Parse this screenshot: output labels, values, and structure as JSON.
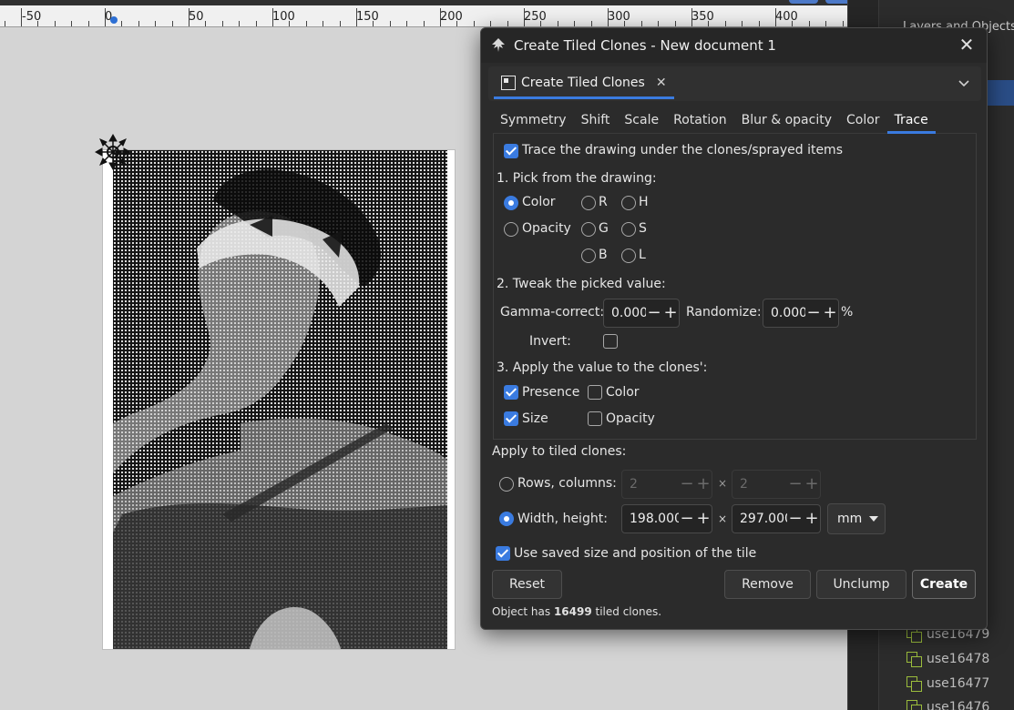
{
  "ruler": {
    "labels": [
      "-50",
      "0",
      "50",
      "100",
      "150",
      "200",
      "250",
      "300",
      "350",
      "400"
    ]
  },
  "side_panel": {
    "tab_title": "Layers and Objects",
    "layers": [
      {
        "label": "use16479"
      },
      {
        "label": "use16478"
      },
      {
        "label": "use16477"
      },
      {
        "label": "use16476"
      }
    ]
  },
  "dialog": {
    "title": "Create Tiled Clones - New document 1",
    "tab_label": "Create Tiled Clones",
    "tabs": [
      {
        "label": "Symmetry"
      },
      {
        "label": "Shift"
      },
      {
        "label": "Scale"
      },
      {
        "label": "Rotation"
      },
      {
        "label": "Blur & opacity"
      },
      {
        "label": "Color"
      },
      {
        "label": "Trace",
        "active": true
      }
    ],
    "trace": {
      "trace_label": "Trace the drawing under the clones/sprayed items",
      "trace_checked": true,
      "pick_heading": "1. Pick from the drawing:",
      "pick_options": {
        "color": "Color",
        "opacity": "Opacity",
        "r": "R",
        "g": "G",
        "b": "B",
        "h": "H",
        "s": "S",
        "l": "L"
      },
      "pick_selected": "Color",
      "tweak_heading": "2. Tweak the picked value:",
      "gamma_label": "Gamma-correct:",
      "gamma_value": "0.000",
      "randomize_label": "Randomize:",
      "randomize_value": "0.000",
      "randomize_unit": "%",
      "invert_label": "Invert:",
      "invert_checked": false,
      "apply_heading": "3. Apply the value to the clones':",
      "presence_label": "Presence",
      "presence_checked": true,
      "color_label": "Color",
      "color_checked": false,
      "size_label": "Size",
      "size_checked": true,
      "opacity_label": "Opacity",
      "opacity_checked": false
    },
    "apply": {
      "heading": "Apply to tiled clones:",
      "rows_label": "Rows, columns:",
      "rows_value": "2",
      "cols_value": "2",
      "times": "×",
      "wh_label": "Width, height:",
      "width_value": "198.0000",
      "height_value": "297.0000",
      "unit": "mm",
      "selected": "Width, height",
      "use_saved_label": "Use saved size and position of the tile",
      "use_saved_checked": true
    },
    "buttons": {
      "reset": "Reset",
      "remove": "Remove",
      "unclump": "Unclump",
      "create": "Create"
    },
    "status": {
      "prefix": "Object has",
      "count": "16499",
      "suffix": "tiled clones."
    }
  },
  "colors": {
    "accent": "#3a7be0",
    "dialog_bg": "#2b2b2b",
    "canvas_bg": "#d4d4d4"
  },
  "icons": {
    "app": "inkscape-icon",
    "close": "close-icon",
    "menu": "chevron-down-icon",
    "tile_handle": "transform-handle-icon"
  }
}
